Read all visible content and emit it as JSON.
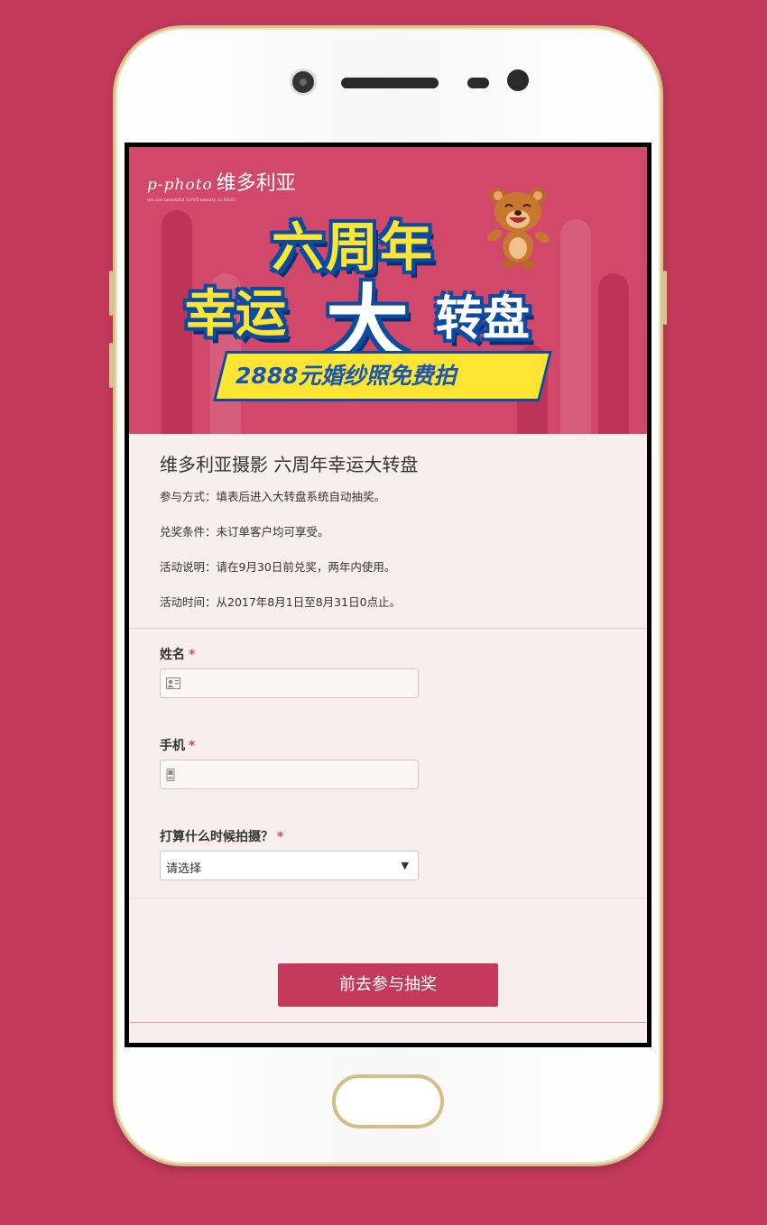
{
  "banner": {
    "logo_script": "p-photo",
    "logo_cn": "维多利亚",
    "logo_tiny": "we are beautiful LOVE beauty to BEST",
    "headline_1": "六周年",
    "headline_2a": "幸运",
    "headline_2b": "大",
    "headline_2c": "转盘",
    "ribbon": "2888元婚纱照免费拍"
  },
  "intro": {
    "title": "维多利亚摄影 六周年幸运大转盘",
    "lines": [
      "参与方式：填表后进入大转盘系统自动抽奖。",
      "兑奖条件：未订单客户均可享受。",
      "活动说明：请在9月30日前兑奖，两年内使用。",
      "活动时间：从2017年8月1日至8月31日0点止。"
    ]
  },
  "form": {
    "name_label": "姓名",
    "phone_label": "手机",
    "when_label": "打算什么时候拍摄？",
    "required_mark": "*",
    "name_value": "",
    "phone_value": "",
    "when_selected": "请选择",
    "submit_label": "前去参与抽奖"
  },
  "colors": {
    "background": "#c33a5a",
    "banner": "#d1486a",
    "accent_yellow": "#ffe533",
    "accent_blue": "#0d4ba0",
    "button": "#c33a5a"
  },
  "icons": {
    "name_field": "contact-card-icon",
    "phone_field": "mobile-phone-icon",
    "select": "dropdown-triangle-icon"
  }
}
